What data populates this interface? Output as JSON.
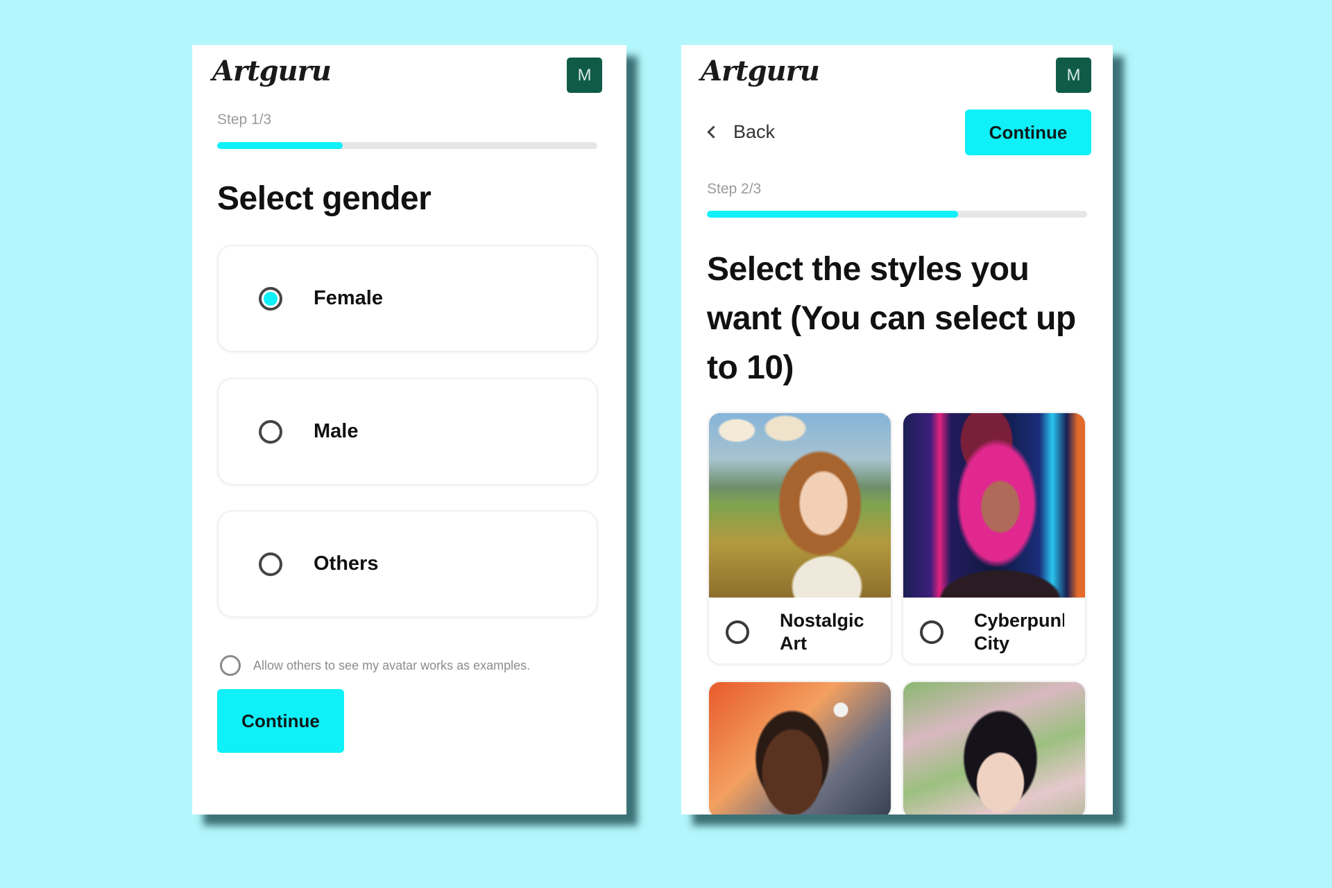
{
  "colors": {
    "background": "#b3f6fb",
    "accent": "#10f0f8",
    "avatar_bg": "#0f5b48"
  },
  "left_screen": {
    "logo": "Artguru",
    "avatar_initial": "M",
    "step_label": "Step 1/3",
    "progress": 0.33,
    "title": "Select gender",
    "options": [
      {
        "label": "Female",
        "selected": true
      },
      {
        "label": "Male",
        "selected": false
      },
      {
        "label": "Others",
        "selected": false
      }
    ],
    "consent": {
      "label": "Allow others to see my avatar works as examples.",
      "checked": false
    },
    "continue_label": "Continue"
  },
  "right_screen": {
    "logo": "Artguru",
    "avatar_initial": "M",
    "back_label": "Back",
    "continue_label": "Continue",
    "step_label": "Step 2/3",
    "progress": 0.66,
    "title": "Select the styles you want (You can select up to 10)",
    "styles": [
      {
        "name": "Nostalgic Art",
        "selected": false,
        "image": "portrait-nostalgic-field"
      },
      {
        "name": "Cyberpunk City",
        "selected": false,
        "image": "portrait-cyberpunk-neon"
      },
      {
        "name": "",
        "selected": false,
        "image": "portrait-sunset-moon"
      },
      {
        "name": "",
        "selected": false,
        "image": "portrait-impressionist-garden"
      }
    ]
  },
  "icons": {
    "back": "chevron-left-icon",
    "radio": "radio-button-icon"
  }
}
